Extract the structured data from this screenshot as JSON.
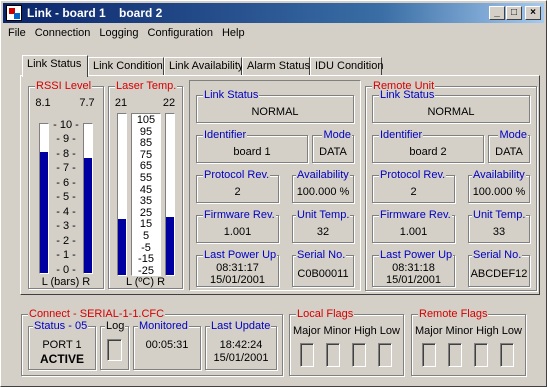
{
  "window": {
    "title": "Link - board 1    board 2",
    "min": "_",
    "max": "□",
    "close": "×"
  },
  "menu": [
    "File",
    "Connection",
    "Logging",
    "Configuration",
    "Help"
  ],
  "tabs": [
    "Link Status",
    "Link Condition",
    "Link Availability",
    "Alarm Status",
    "IDU Condition"
  ],
  "rssi": {
    "label": "RSSI Level",
    "left_value": "8.1",
    "right_value": "7.7",
    "scale": [
      "10",
      "9",
      "8",
      "7",
      "6",
      "5",
      "4",
      "3",
      "2",
      "1",
      "0"
    ],
    "left_fill_pct": 81,
    "right_fill_pct": 77,
    "footer": "L  (bars)  R"
  },
  "laser": {
    "label": "Laser Temp.",
    "left_value": "21",
    "right_value": "22",
    "scale": [
      "105",
      "95",
      "85",
      "75",
      "65",
      "55",
      "45",
      "35",
      "25",
      "15",
      "5",
      "-5",
      "-15",
      "-25"
    ],
    "left_fill_pct": 35,
    "right_fill_pct": 36,
    "footer": "L  (ºC)  R"
  },
  "local": {
    "link_status_label": "Link Status",
    "link_status": "NORMAL",
    "identifier_label": "Identifier",
    "identifier": "board 1",
    "mode_label": "Mode",
    "mode": "DATA",
    "protocol_label": "Protocol Rev.",
    "protocol": "2",
    "availability_label": "Availability",
    "availability": "100.000 %",
    "firmware_label": "Firmware Rev.",
    "firmware": "1.001",
    "unit_temp_label": "Unit Temp.",
    "unit_temp": "32",
    "power_label": "Last Power Up",
    "power_time": "08:31:17",
    "power_date": "15/01/2001",
    "serial_label": "Serial No.",
    "serial": "C0B00011"
  },
  "remote": {
    "title": "Remote Unit",
    "link_status_label": "Link Status",
    "link_status": "NORMAL",
    "identifier_label": "Identifier",
    "identifier": "board 2",
    "mode_label": "Mode",
    "mode": "DATA",
    "protocol_label": "Protocol Rev.",
    "protocol": "2",
    "availability_label": "Availability",
    "availability": "100.000 %",
    "firmware_label": "Firmware Rev.",
    "firmware": "1.001",
    "unit_temp_label": "Unit Temp.",
    "unit_temp": "33",
    "power_label": "Last Power Up",
    "power_time": "08:31:18",
    "power_date": "15/01/2001",
    "serial_label": "Serial No.",
    "serial": "ABCDEF12"
  },
  "connect": {
    "label": "Connect - SERIAL-1-1.CFC",
    "status_label": "Status - 05",
    "port": "PORT 1",
    "state": "ACTIVE",
    "log_label": "Log",
    "monitored_label": "Monitored",
    "monitored": "00:05:31",
    "update_label": "Last Update",
    "update_time": "18:42:24",
    "update_date": "15/01/2001"
  },
  "local_flags": {
    "label": "Local Flags",
    "columns": "Major Minor High Low"
  },
  "remote_flags": {
    "label": "Remote Flags",
    "columns": "Major Minor High Low"
  },
  "colors": {
    "title_bar": "#0a246a",
    "group_label": "#d60000",
    "bar_fill": "#0000a0",
    "face": "#d4d0c8"
  }
}
